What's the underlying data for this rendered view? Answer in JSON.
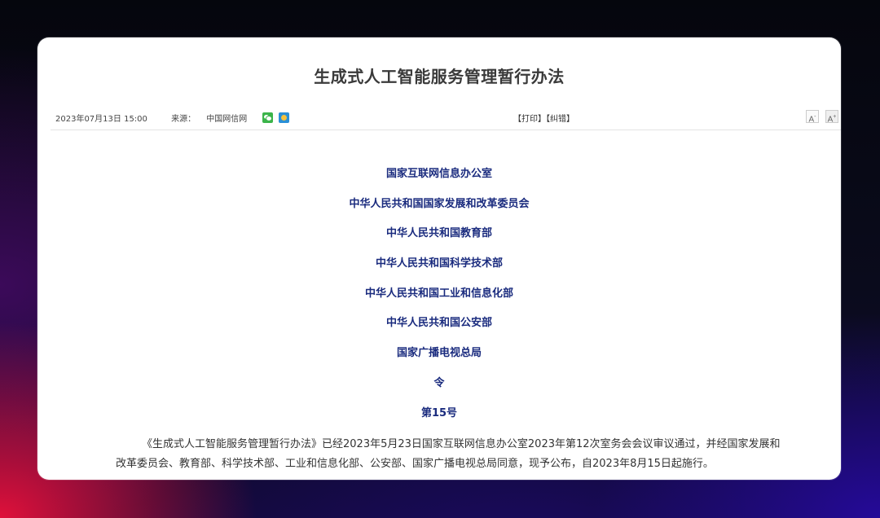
{
  "article": {
    "title": "生成式人工智能服务管理暂行办法",
    "date": "2023年07月13日 15:00",
    "source_label": "来源：",
    "source": "中国网信网",
    "share_icons": [
      "wechat-share-icon",
      "weibo-share-icon"
    ],
    "print_label": "【打印】",
    "correction_label": "【纠错】",
    "font_smaller_label": "A",
    "font_smaller_sup": "-",
    "font_larger_label": "A",
    "font_larger_sup": "+"
  },
  "issuers": [
    "国家互联网信息办公室",
    "中华人民共和国国家发展和改革委员会",
    "中华人民共和国教育部",
    "中华人民共和国科学技术部",
    "中华人民共和国工业和信息化部",
    "中华人民共和国公安部",
    "国家广播电视总局",
    "令",
    "第15号"
  ],
  "body": {
    "paragraph": "《生成式人工智能服务管理暂行办法》已经2023年5月23日国家互联网信息办公室2023年第12次室务会会议审议通过，并经国家发展和改革委员会、教育部、科学技术部、工业和信息化部、公安部、国家广播电视总局同意，现予公布，自2023年8月15日起施行。"
  },
  "colors": {
    "issuer_text": "#1a2b7e",
    "title_text": "#3a3a3a",
    "card_background": "#ffffff"
  }
}
